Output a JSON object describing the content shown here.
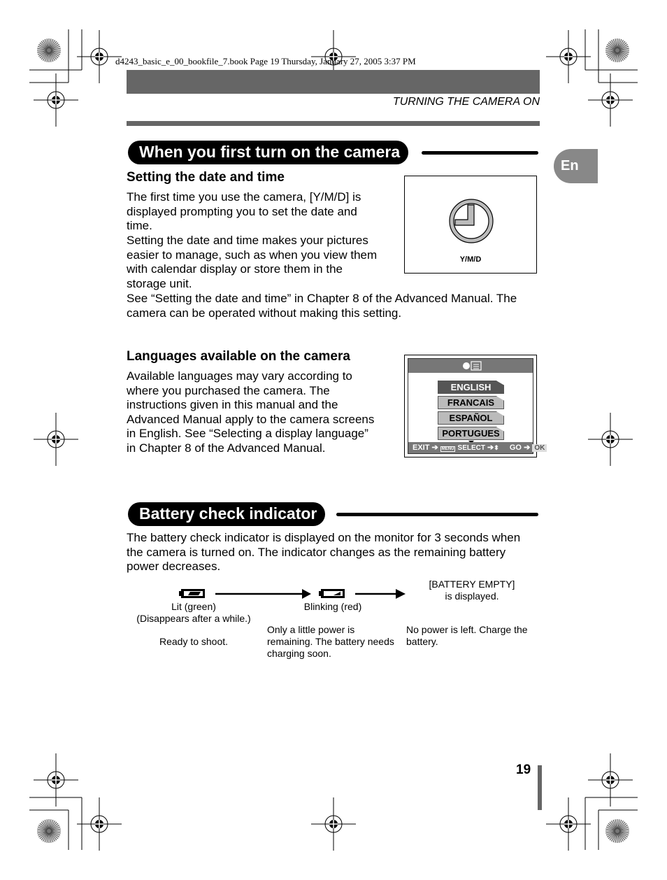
{
  "book_line": "d4243_basic_e_00_bookfile_7.book  Page 19  Thursday, January 27, 2005  3:37 PM",
  "running_head": "TURNING THE CAMERA ON",
  "lang_tab": "En",
  "section1": {
    "title": "When you first turn on the camera",
    "sub1": {
      "heading": "Setting the date and time",
      "paragraphs": [
        "The first time you use the camera, [Y/M/D] is displayed prompting you to set the date and time.",
        "Setting the date and time makes your pictures easier to manage, such as when you view them with calendar display or store them in the storage unit.",
        "See “Setting the date and time” in Chapter 8 of the Advanced Manual. The camera can be operated without making this setting."
      ],
      "screen_label": "Y/M/D",
      "screen_icon": "clock-icon"
    },
    "sub2": {
      "heading": "Languages available on the camera",
      "paragraph": "Available languages may vary according to where you purchased the camera. The instructions given in this manual and the Advanced Manual apply to the camera screens in English. See “Selecting a display language” in Chapter 8 of the Advanced Manual.",
      "screen": {
        "header_icon": "language-icon",
        "languages": [
          "ENGLISH",
          "FRANCAIS",
          "ESPAÑOL",
          "PORTUGUES"
        ],
        "selected": "ENGLISH",
        "footer": {
          "exit": "EXIT",
          "menu": "MENU",
          "select": "SELECT",
          "go": "GO",
          "ok": "OK"
        }
      }
    }
  },
  "section2": {
    "title": "Battery check indicator",
    "paragraph": "The battery check indicator is displayed on the monitor for 3 seconds when the camera is turned on. The indicator changes as the remaining battery power decreases.",
    "states": [
      {
        "icon": "battery-full-icon",
        "label1": "Lit (green)",
        "label2": "(Disappears after a while.)",
        "desc": "Ready to shoot."
      },
      {
        "icon": "battery-low-icon",
        "label1": "Blinking (red)",
        "label2": "",
        "desc": "Only a little power is remaining. The battery needs charging soon."
      },
      {
        "icon": "",
        "label1": "[BATTERY EMPTY]",
        "label2": "is displayed.",
        "desc": "No power is left. Charge the battery."
      }
    ]
  },
  "page_number": "19"
}
